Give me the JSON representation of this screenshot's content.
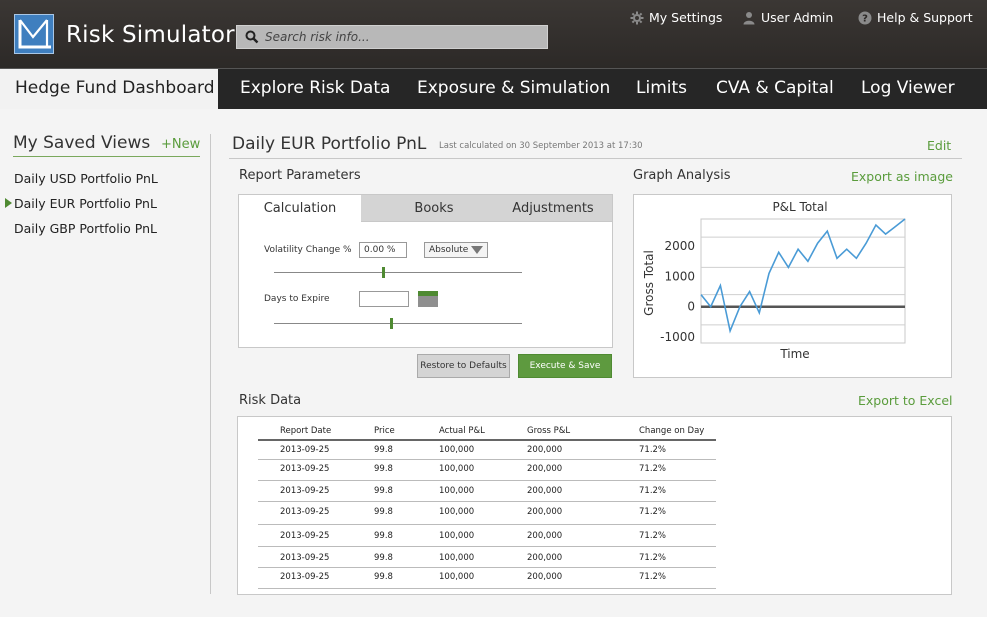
{
  "app": {
    "title": "Risk Simulator"
  },
  "search": {
    "placeholder": "Search risk info..."
  },
  "top_links": {
    "settings": "My Settings",
    "user": "User Admin",
    "help": "Help & Support"
  },
  "nav": {
    "tabs": [
      {
        "label": "Hedge Fund Dashboard",
        "active": true
      },
      {
        "label": "Explore Risk Data",
        "active": false
      },
      {
        "label": "Exposure & Simulation",
        "active": false
      },
      {
        "label": "Limits",
        "active": false
      },
      {
        "label": "CVA & Capital",
        "active": false
      },
      {
        "label": "Log Viewer",
        "active": false
      }
    ]
  },
  "sidebar": {
    "title": "My Saved Views",
    "new_label": "+New",
    "items": [
      {
        "label": "Daily USD Portfolio PnL",
        "selected": false
      },
      {
        "label": "Daily EUR Portfolio PnL",
        "selected": true
      },
      {
        "label": "Daily GBP Portfolio PnL",
        "selected": false
      }
    ]
  },
  "main": {
    "title": "Daily EUR Portfolio PnL",
    "last_calculated": "Last calculated on 30 September 2013 at 17:30",
    "edit_label": "Edit"
  },
  "report_params": {
    "title": "Report Parameters",
    "tabs": [
      {
        "label": "Calculation",
        "active": true
      },
      {
        "label": "Books",
        "active": false
      },
      {
        "label": "Adjustments",
        "active": false
      }
    ],
    "volatility": {
      "label": "Volatility Change %",
      "value": "0.00 %",
      "mode": "Absolute",
      "slider_fraction": 0.44
    },
    "days": {
      "label": "Days to Expire",
      "value": "",
      "slider_fraction": 0.47
    },
    "restore_label": "Restore to Defaults",
    "execute_label": "Execute & Save"
  },
  "graph": {
    "title": "Graph Analysis",
    "export_label": "Export as image"
  },
  "chart_data": {
    "type": "line",
    "title": "P&L Total",
    "xlabel": "Time",
    "ylabel": "Gross Total",
    "ylim": [
      -1200,
      2900
    ],
    "yticks": [
      2000,
      1000,
      0,
      -1000
    ],
    "ytick_labels": [
      "2000",
      "1000",
      "0",
      "-1000"
    ],
    "gridlines": [
      2300,
      1300,
      400,
      -600
    ],
    "grid": true,
    "x": [
      0,
      1,
      2,
      3,
      4,
      5,
      6,
      7,
      8,
      9,
      10,
      11,
      12,
      13,
      14,
      15,
      16,
      17,
      18,
      19,
      20,
      21
    ],
    "series": [
      {
        "color": "#4a9bd6",
        "values": [
          400,
          0,
          700,
          -800,
          0,
          500,
          -200,
          1100,
          1800,
          1300,
          1900,
          1500,
          2100,
          2500,
          1600,
          1900,
          1600,
          2100,
          2700,
          2400,
          2650,
          2900
        ]
      }
    ],
    "baseline": 0,
    "baseline_color": "#555555"
  },
  "risk_data": {
    "title": "Risk Data",
    "export_label": "Export to Excel",
    "columns": [
      "Report Date",
      "Price",
      "Actual P&L",
      "Gross P&L",
      "Change on Day"
    ],
    "rows": [
      [
        "2013-09-25",
        "99.8",
        "100,000",
        "200,000",
        "71.2%"
      ],
      [
        "2013-09-25",
        "99.8",
        "100,000",
        "200,000",
        "71.2%"
      ],
      [
        "2013-09-25",
        "99.8",
        "100,000",
        "200,000",
        "71.2%"
      ],
      [
        "2013-09-25",
        "99.8",
        "100,000",
        "200,000",
        "71.2%"
      ],
      [
        "2013-09-25",
        "99.8",
        "100,000",
        "200,000",
        "71.2%"
      ],
      [
        "2013-09-25",
        "99.8",
        "100,000",
        "200,000",
        "71.2%"
      ],
      [
        "2013-09-25",
        "99.8",
        "100,000",
        "200,000",
        "71.2%"
      ]
    ]
  },
  "colors": {
    "accent_green": "#5a9c3c",
    "header_dark": "#2c2927",
    "nav_dark": "#262626",
    "logo_blue": "#3f7fbf",
    "chart_line": "#4a9bd6"
  }
}
